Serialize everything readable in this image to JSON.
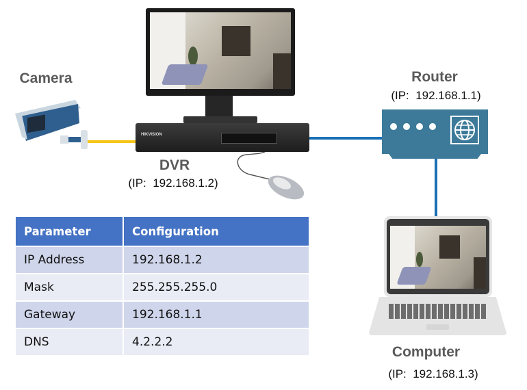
{
  "devices": {
    "camera": {
      "title": "Camera"
    },
    "dvr": {
      "title": "DVR",
      "ip": "(IP:  192.168.1.2)",
      "brand": "HIKVISION"
    },
    "router": {
      "title": "Router",
      "ip": "(IP:  192.168.1.1)"
    },
    "computer": {
      "title": "Computer",
      "ip": "(IP:  192.168.1.3)"
    }
  },
  "table": {
    "headers": [
      "Parameter",
      "Configuration"
    ],
    "rows": [
      [
        "IP Address",
        "192.168.1.2"
      ],
      [
        "Mask",
        "255.255.255.0"
      ],
      [
        "Gateway",
        "192.168.1.1"
      ],
      [
        "DNS",
        "4.2.2.2"
      ]
    ]
  },
  "colors": {
    "header": "#4472c4",
    "row_odd": "#cfd5ea",
    "row_even": "#e9ebf5",
    "link_blue": "#1a6fb5",
    "link_yellow": "#f5c518",
    "router_body": "#3d7a9a"
  }
}
